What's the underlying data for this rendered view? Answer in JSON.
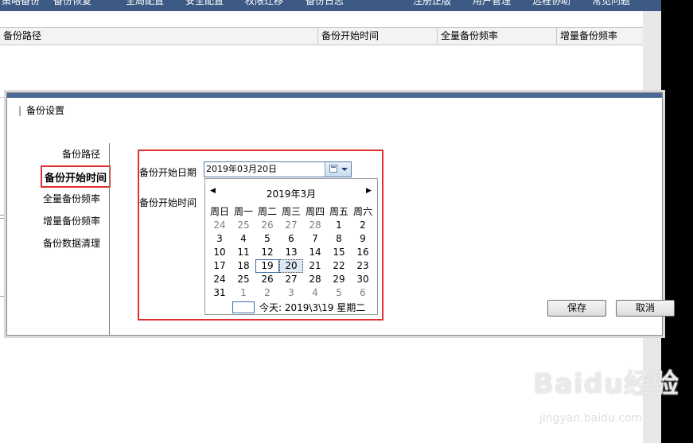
{
  "topnav": {
    "items": [
      "策略备份",
      "备份恢复",
      "全局配置",
      "安全配置",
      "权限迁移",
      "备份日志",
      "注册正版",
      "用户管理",
      "远程协助",
      "常见问题"
    ]
  },
  "table": {
    "headers": [
      "备份路径",
      "备份开始时间",
      "全量备份频率",
      "增量备份频率"
    ]
  },
  "dialog": {
    "title": "备份设置",
    "close_label": "×",
    "sidebar": [
      "备份路径",
      "备份开始时间",
      "全量备份频率",
      "增量备份频率",
      "备份数据清理"
    ],
    "active_index": 1,
    "fields": {
      "start_date_label": "备份开始日期",
      "start_time_label": "备份开始时间",
      "start_date_value": "2019年03月20日"
    },
    "calendar": {
      "prev": "◀",
      "next": "▶",
      "month_title": "2019年3月",
      "weekdays": [
        "周日",
        "周一",
        "周二",
        "周三",
        "周四",
        "周五",
        "周六"
      ],
      "weeks": [
        [
          "24",
          "25",
          "26",
          "27",
          "28",
          "1",
          "2"
        ],
        [
          "3",
          "4",
          "5",
          "6",
          "7",
          "8",
          "9"
        ],
        [
          "10",
          "11",
          "12",
          "13",
          "14",
          "15",
          "16"
        ],
        [
          "17",
          "18",
          "19",
          "20",
          "21",
          "22",
          "23"
        ],
        [
          "24",
          "25",
          "26",
          "27",
          "28",
          "29",
          "30"
        ],
        [
          "31",
          "1",
          "2",
          "3",
          "4",
          "5",
          "6"
        ]
      ],
      "today_label": "今天: 2019\\3\\19 星期二"
    },
    "buttons": {
      "ok": "保存",
      "cancel": "取消"
    }
  },
  "watermark": {
    "logo": "Baidu经验",
    "url": "jingyan.baidu.com"
  },
  "colors": {
    "nav": "#3c5a84",
    "highlight": "#e03030",
    "accent": "#3a6ea5"
  }
}
